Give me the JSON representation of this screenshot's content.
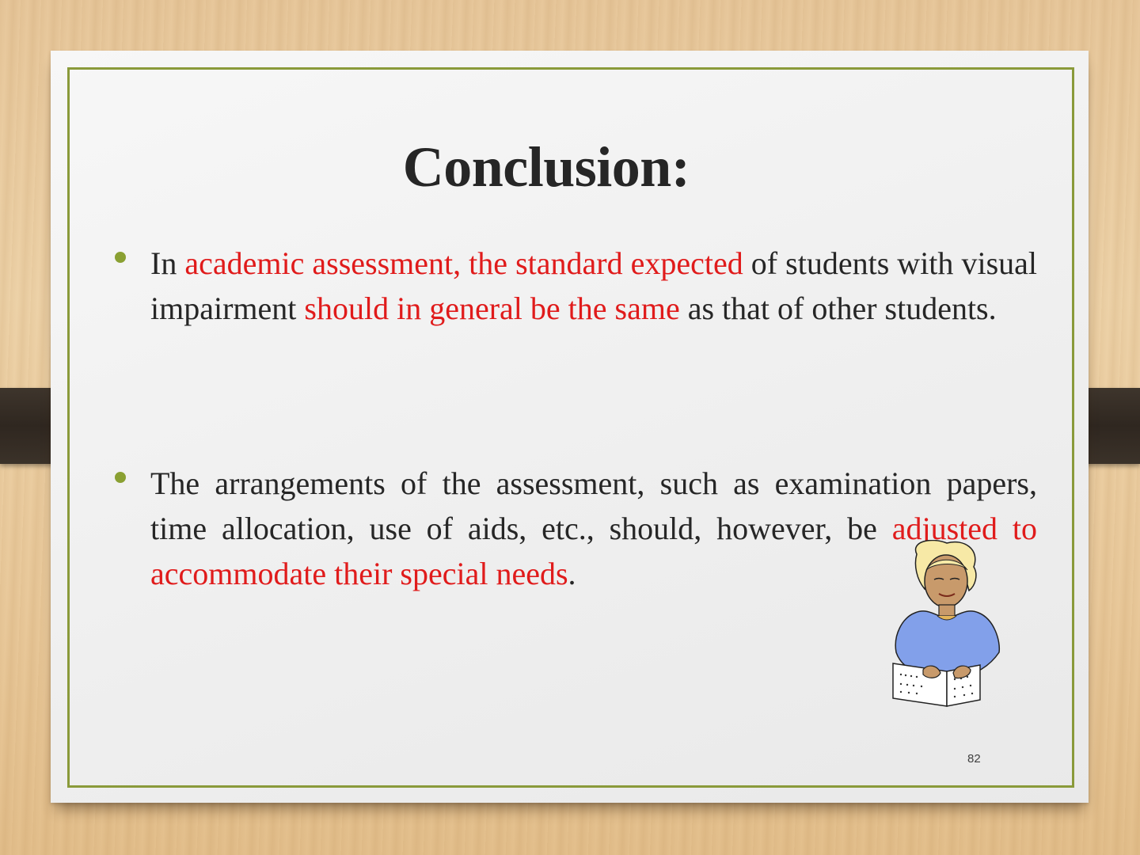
{
  "slide": {
    "title": "Conclusion:",
    "page_number": "82",
    "bullets": [
      {
        "segments": [
          {
            "text": "In ",
            "highlight": false
          },
          {
            "text": "academic assessment, the standard expected",
            "highlight": true
          },
          {
            "text": " of students with visual impairment ",
            "highlight": false
          },
          {
            "text": "should in general be the same",
            "highlight": true
          },
          {
            "text": " as that of other students.",
            "highlight": false
          }
        ]
      },
      {
        "segments": [
          {
            "text": "The arrangements of the assessment, such as examination papers, time allocation, use of aids, etc., should, however, be ",
            "highlight": false
          },
          {
            "text": "adjusted to accommodate their special needs",
            "highlight": true
          },
          {
            "text": ".",
            "highlight": false
          }
        ]
      }
    ],
    "colors": {
      "text": "#262626",
      "highlight": "#e01b1b",
      "bullet": "#8aa032",
      "frame": "#8a9a3a"
    },
    "illustration_icon": "braille-reader-icon"
  }
}
